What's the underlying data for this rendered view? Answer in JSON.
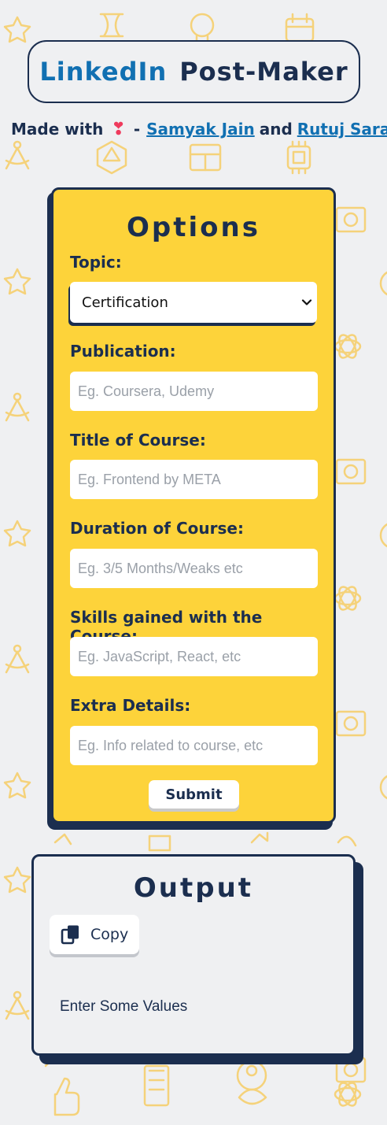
{
  "header": {
    "title_part1": "LinkedIn",
    "title_part2": "Post-Maker"
  },
  "credits": {
    "prefix": "Made with",
    "heart": "❣",
    "dash": "-",
    "author1": "Samyak Jain",
    "and": "and",
    "author2": "Rutuj Saraf"
  },
  "options": {
    "heading": "Options",
    "topic_label": "Topic:",
    "topic_selected": "Certification",
    "fields": [
      {
        "label": "Publication:",
        "placeholder": "Eg. Coursera, Udemy",
        "value": ""
      },
      {
        "label": "Title of Course:",
        "placeholder": "Eg. Frontend by META",
        "value": ""
      },
      {
        "label": "Duration of Course:",
        "placeholder": "Eg. 3/5 Months/Weaks etc",
        "value": ""
      },
      {
        "label": "Skills gained with the Course:",
        "placeholder": "Eg. JavaScript, React, etc",
        "value": ""
      },
      {
        "label": "Extra Details:",
        "placeholder": "Eg. Info related to course, etc",
        "value": ""
      }
    ],
    "submit_label": "Submit"
  },
  "output": {
    "heading": "Output",
    "copy_label": "Copy",
    "text": "Enter Some Values"
  },
  "colors": {
    "accent_yellow": "#fdd33a",
    "navy": "#1b2e4f",
    "link_blue": "#1170b2",
    "background": "#eff0f2",
    "heart": "#ef3b5d"
  },
  "icons": [
    "heart-icon",
    "chevron-down-icon",
    "copy-icon",
    "background-pattern"
  ]
}
